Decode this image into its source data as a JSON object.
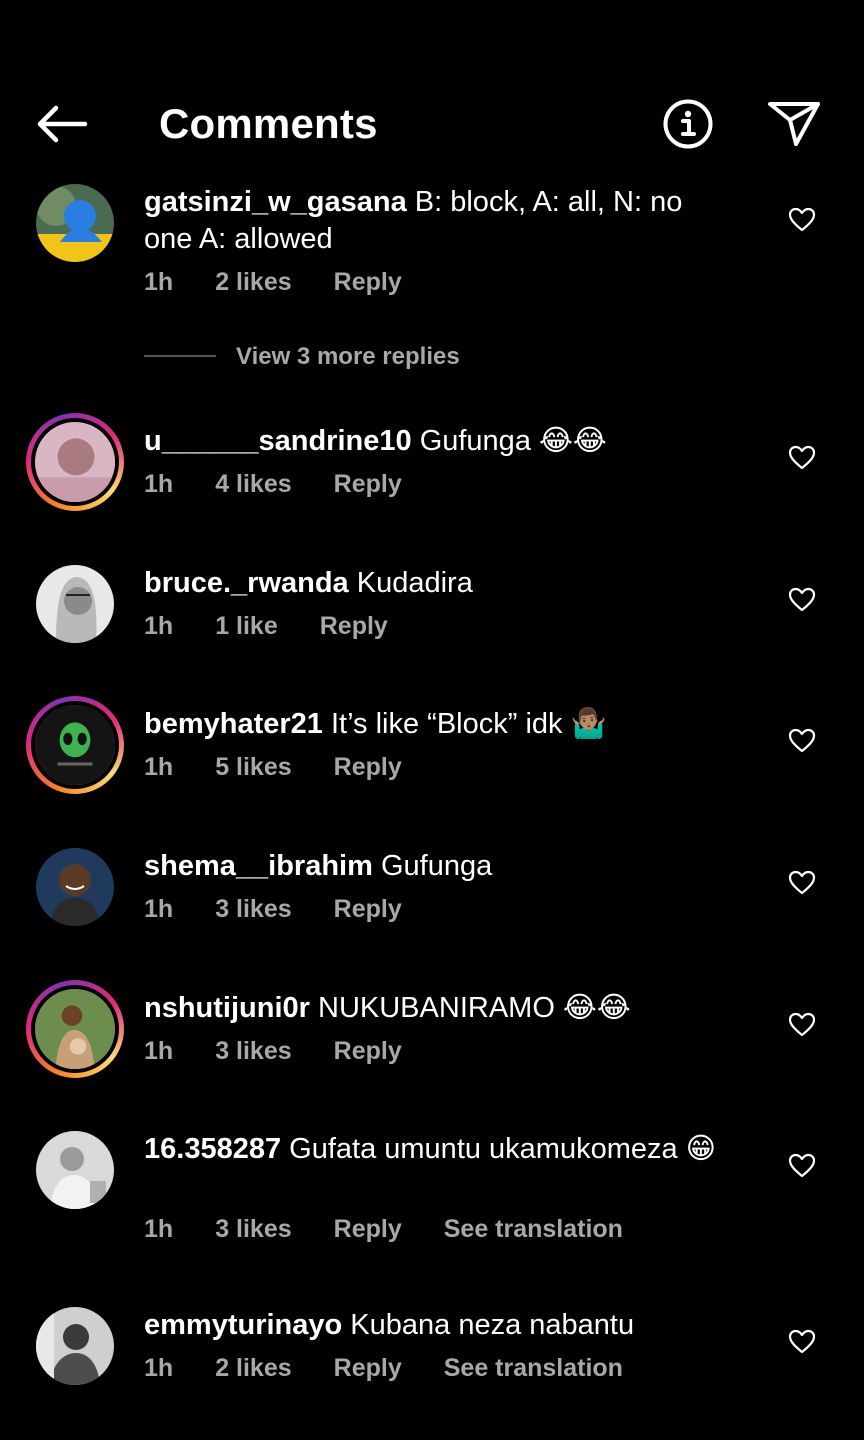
{
  "header": {
    "title": "Comments",
    "back_icon": "arrow-left-icon",
    "info_icon": "info-icon",
    "send_icon": "send-icon"
  },
  "colors": {
    "background": "#000000",
    "meta_text": "#a8a8a8",
    "story_ring_a": "#f58529",
    "story_ring_b": "#dd2a7b"
  },
  "comments": [
    {
      "username": "gatsinzi_w_gasana",
      "text": "B: block,  A: all,  N: no one  A: allowed",
      "time": "1h",
      "likes": "2 likes",
      "reply": "Reply",
      "story": false
    },
    {
      "username": "u______sandrine10",
      "text": "Gufunga 😂😂",
      "time": "1h",
      "likes": "4 likes",
      "reply": "Reply",
      "story": true
    },
    {
      "username": "bruce._rwanda",
      "text": "Kudadira",
      "time": "1h",
      "likes": "1 like",
      "reply": "Reply",
      "story": false
    },
    {
      "username": "bemyhater21",
      "text": "It’s like “Block” idk 🤷🏽‍♂️",
      "time": "1h",
      "likes": "5 likes",
      "reply": "Reply",
      "story": true
    },
    {
      "username": "shema__ibrahim",
      "text": "Gufunga",
      "time": "1h",
      "likes": "3 likes",
      "reply": "Reply",
      "story": false
    },
    {
      "username": "nshutijuni0r",
      "text": "NUKUBANIRAMO 😂😂",
      "time": "1h",
      "likes": "3 likes",
      "reply": "Reply",
      "story": true
    },
    {
      "username": "16.358287",
      "text": "Gufata umuntu ukamukomeza 😁",
      "time": "1h",
      "likes": "3 likes",
      "reply": "Reply",
      "translate": "See translation",
      "story": false
    },
    {
      "username": "emmyturinayo",
      "text": "Kubana neza nabantu",
      "time": "1h",
      "likes": "2 likes",
      "reply": "Reply",
      "translate": "See translation",
      "story": false
    }
  ],
  "view_replies": "View 3 more replies"
}
